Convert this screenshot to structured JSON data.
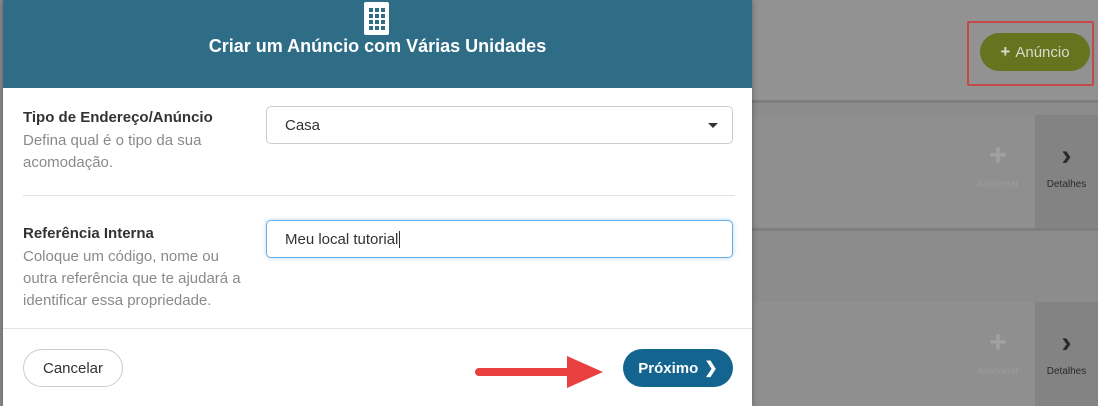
{
  "colors": {
    "header_bg": "#2f6d87",
    "primary_button": "#136590",
    "add_button": "#66741f",
    "annotation_red": "#e8403f"
  },
  "modal": {
    "title": "Criar um Anúncio com Várias Unidades",
    "icon": "building-icon",
    "address_type": {
      "label": "Tipo de Endereço/Anúncio",
      "help": "Defina qual é o tipo da sua acomodação.",
      "selected": "Casa"
    },
    "internal_ref": {
      "label": "Referência Interna",
      "help": "Coloque um código, nome ou outra referência que te ajudará a identificar essa propriedade.",
      "value": "Meu local tutorial"
    },
    "footer": {
      "cancel": "Cancelar",
      "next": "Próximo"
    }
  },
  "background": {
    "add_listing_button": "Anúncio",
    "rows": [
      {
        "add_label": "Adicionar",
        "details_label": "Detalhes"
      },
      {
        "add_label": "Adicionar",
        "details_label": "Detalhes"
      }
    ]
  }
}
